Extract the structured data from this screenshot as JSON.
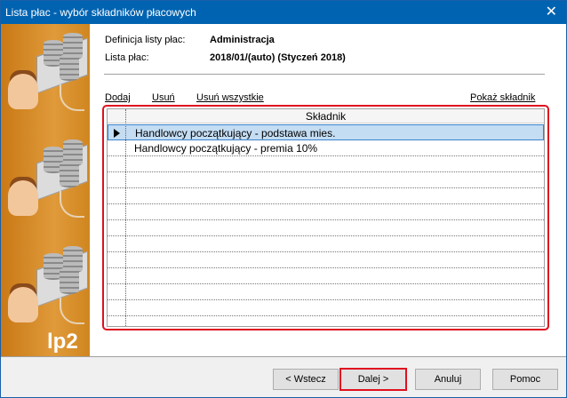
{
  "window": {
    "title": "Lista płac - wybór składników płacowych",
    "close_icon": "close-icon"
  },
  "side": {
    "logo": "lp2"
  },
  "info": {
    "definition_label": "Definicja listy płac:",
    "definition_value": "Administracja",
    "list_label": "Lista płac:",
    "list_value": "2018/01/(auto) (Styczeń 2018)"
  },
  "links": {
    "add": "Dodaj",
    "remove": "Usuń",
    "remove_all": "Usuń wszystkie",
    "show": "Pokaż składnik"
  },
  "grid": {
    "header": "Składnik",
    "rows": [
      "Handlowcy początkujący - podstawa mies.",
      "Handlowcy początkujący - premia 10%"
    ],
    "selected_index": 0
  },
  "buttons": {
    "back": "< Wstecz",
    "next": "Dalej >",
    "cancel": "Anuluj",
    "help": "Pomoc"
  }
}
